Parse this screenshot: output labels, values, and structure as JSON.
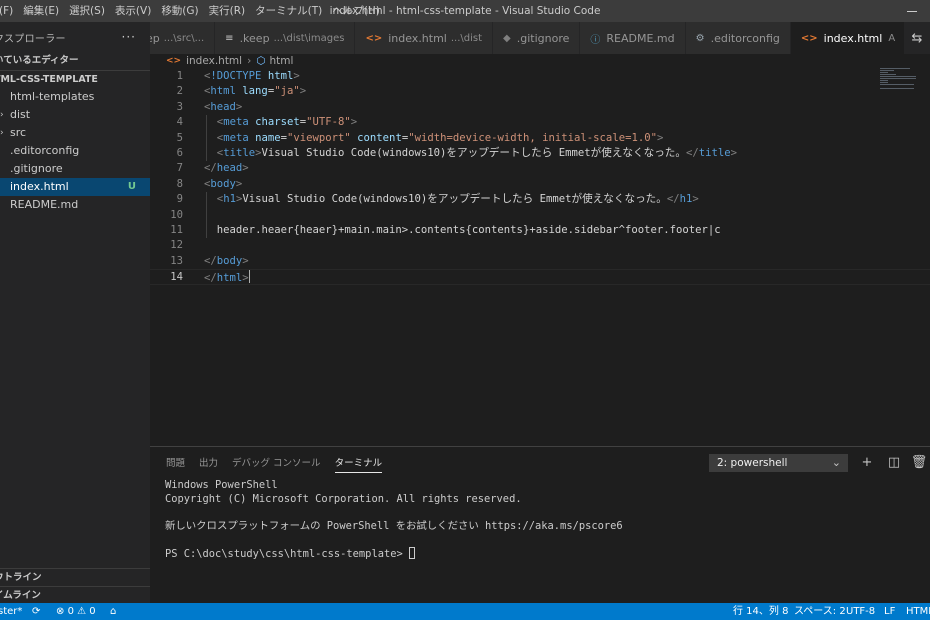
{
  "menu": [
    "(F)",
    "編集(E)",
    "選択(S)",
    "表示(V)",
    "移動(G)",
    "実行(R)",
    "ターミナル(T)",
    "ヘルプ(H)"
  ],
  "window_title": "index.html - html-css-template - Visual Studio Code",
  "sidebar": {
    "title": "クスプローラー",
    "more": "···",
    "open_editors": "いているエディター",
    "project": "TML-CSS-TEMPLATE",
    "files": [
      {
        "label": "html-templates",
        "folder": false
      },
      {
        "label": "dist",
        "folder": true
      },
      {
        "label": "src",
        "folder": true
      },
      {
        "label": ".editorconfig",
        "folder": false
      },
      {
        "label": ".gitignore",
        "folder": false
      },
      {
        "label": "index.html",
        "folder": false,
        "selected": true,
        "badge": "U"
      },
      {
        "label": "README.md",
        "folder": false
      }
    ],
    "outline": "ウトライン",
    "timeline": "イムライン"
  },
  "tabs": [
    {
      "label": "ep",
      "desc": "...\\src\\...",
      "icon": "none"
    },
    {
      "label": ".keep",
      "desc": "...\\dist\\images",
      "icon": "keep-file-icon"
    },
    {
      "label": "index.html",
      "desc": "...\\dist",
      "icon": "html-file-icon"
    },
    {
      "label": ".gitignore",
      "desc": "",
      "icon": "git-file-icon"
    },
    {
      "label": "README.md",
      "desc": "",
      "icon": "info-file-icon"
    },
    {
      "label": ".editorconfig",
      "desc": "",
      "icon": "gear-file-icon"
    },
    {
      "label": "index.html",
      "desc": "",
      "icon": "html-file-icon",
      "active": true,
      "marker": "A"
    }
  ],
  "breadcrumb": [
    "index.html",
    "html"
  ],
  "code_lines": [
    {
      "n": "1",
      "indent": 0,
      "tokens": [
        [
          "punc",
          "<"
        ],
        [
          "tag",
          "!DOCTYPE"
        ],
        [
          "text",
          " "
        ],
        [
          "attr",
          "html"
        ],
        [
          "punc",
          ">"
        ]
      ]
    },
    {
      "n": "2",
      "indent": 0,
      "tokens": [
        [
          "punc",
          "<"
        ],
        [
          "tag",
          "html"
        ],
        [
          "text",
          " "
        ],
        [
          "attr",
          "lang"
        ],
        [
          "text",
          "="
        ],
        [
          "str",
          "\"ja\""
        ],
        [
          "punc",
          ">"
        ]
      ]
    },
    {
      "n": "3",
      "indent": 0,
      "tokens": [
        [
          "punc",
          "<"
        ],
        [
          "tag",
          "head"
        ],
        [
          "punc",
          ">"
        ]
      ]
    },
    {
      "n": "4",
      "indent": 1,
      "tokens": [
        [
          "punc",
          "<"
        ],
        [
          "tag",
          "meta"
        ],
        [
          "text",
          " "
        ],
        [
          "attr",
          "charset"
        ],
        [
          "text",
          "="
        ],
        [
          "str",
          "\"UTF-8\""
        ],
        [
          "punc",
          ">"
        ]
      ]
    },
    {
      "n": "5",
      "indent": 1,
      "tokens": [
        [
          "punc",
          "<"
        ],
        [
          "tag",
          "meta"
        ],
        [
          "text",
          " "
        ],
        [
          "attr",
          "name"
        ],
        [
          "text",
          "="
        ],
        [
          "str",
          "\"viewport\""
        ],
        [
          "text",
          " "
        ],
        [
          "attr",
          "content"
        ],
        [
          "text",
          "="
        ],
        [
          "str",
          "\"width=device-width, initial-scale=1.0\""
        ],
        [
          "punc",
          ">"
        ]
      ]
    },
    {
      "n": "6",
      "indent": 1,
      "tokens": [
        [
          "punc",
          "<"
        ],
        [
          "tag",
          "title"
        ],
        [
          "punc",
          ">"
        ],
        [
          "text",
          "Visual Studio Code(windows10)をアップデートしたら Emmetが使えなくなった。"
        ],
        [
          "punc",
          "</"
        ],
        [
          "tag",
          "title"
        ],
        [
          "punc",
          ">"
        ]
      ]
    },
    {
      "n": "7",
      "indent": 0,
      "tokens": [
        [
          "punc",
          "</"
        ],
        [
          "tag",
          "head"
        ],
        [
          "punc",
          ">"
        ]
      ]
    },
    {
      "n": "8",
      "indent": 0,
      "tokens": [
        [
          "punc",
          "<"
        ],
        [
          "tag",
          "body"
        ],
        [
          "punc",
          ">"
        ]
      ]
    },
    {
      "n": "9",
      "indent": 1,
      "tokens": [
        [
          "punc",
          "<"
        ],
        [
          "tag",
          "h1"
        ],
        [
          "punc",
          ">"
        ],
        [
          "text",
          "Visual Studio Code(windows10)をアップデートしたら Emmetが使えなくなった。"
        ],
        [
          "punc",
          "</"
        ],
        [
          "tag",
          "h1"
        ],
        [
          "punc",
          ">"
        ]
      ]
    },
    {
      "n": "10",
      "indent": 0,
      "tokens": []
    },
    {
      "n": "11",
      "indent": 1,
      "tokens": [
        [
          "text",
          "header.heaer{heaer}+main.main>.contents{contents}+aside.sidebar^footer.footer|c"
        ]
      ]
    },
    {
      "n": "12",
      "indent": 0,
      "tokens": []
    },
    {
      "n": "13",
      "indent": 0,
      "tokens": [
        [
          "punc",
          "</"
        ],
        [
          "tag",
          "body"
        ],
        [
          "punc",
          ">"
        ]
      ]
    },
    {
      "n": "14",
      "indent": 0,
      "tokens": [
        [
          "punc",
          "</"
        ],
        [
          "tag",
          "html"
        ],
        [
          "punc",
          ">"
        ]
      ],
      "current": true
    }
  ],
  "panel": {
    "tabs": [
      "問題",
      "出力",
      "デバッグ コンソール",
      "ターミナル"
    ],
    "active_tab": 3,
    "terminal_select": "2: powershell",
    "terminal_lines": [
      "Windows PowerShell",
      "Copyright (C) Microsoft Corporation. All rights reserved.",
      "",
      "新しいクロスプラットフォームの PowerShell をお試しください https://aka.ms/pscore6",
      "",
      "PS C:\\doc\\study\\css\\html-css-template> "
    ]
  },
  "status": {
    "branch": "ster*",
    "errors": "0",
    "warnings": "0",
    "position": "行 14、列 8",
    "spaces": "スペース: 2",
    "encoding": "UTF-8",
    "eol": "LF",
    "language": "HTML"
  },
  "colors": {
    "statusbar": "#007acc",
    "selection": "#094771",
    "tag": "#569cd6",
    "attr": "#9cdcfe",
    "string": "#ce9178"
  }
}
